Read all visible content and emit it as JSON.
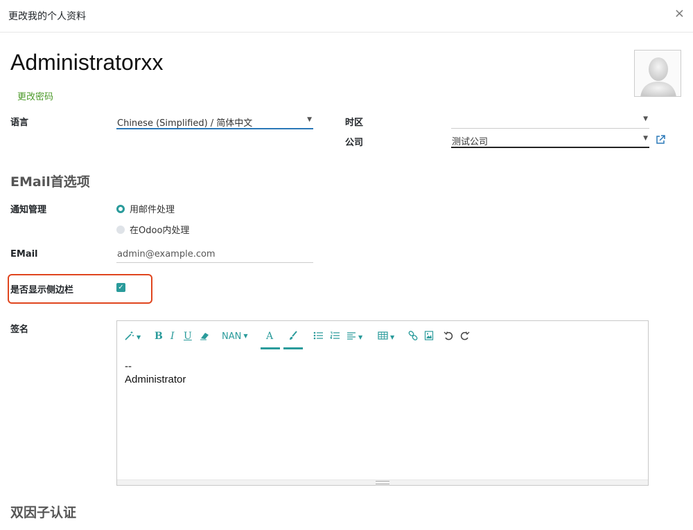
{
  "dialog": {
    "title": "更改我的个人资料",
    "close_glyph": "×"
  },
  "user": {
    "name": "Administratorxx",
    "change_password": "更改密码"
  },
  "fields": {
    "language": {
      "label": "语言",
      "value": "Chinese (Simplified) / 简体中文"
    },
    "timezone": {
      "label": "时区",
      "value": ""
    },
    "company": {
      "label": "公司",
      "value": "测试公司"
    }
  },
  "email_section": {
    "title": "EMail首选项",
    "notification": {
      "label": "通知管理",
      "options": [
        "用邮件处理",
        "在Odoo内处理"
      ],
      "selected": "用邮件处理"
    },
    "email": {
      "label": "EMail",
      "value": "admin@example.com"
    },
    "show_sidebar": {
      "label": "是否显示侧边栏",
      "checked": true
    }
  },
  "signature": {
    "label": "签名",
    "toolbar": {
      "font_size": "NAN",
      "bold": "B",
      "italic": "I",
      "underline": "U",
      "font_color": "A"
    },
    "content_lines": [
      "--",
      "Administrator"
    ]
  },
  "two_factor": {
    "title": "双因子认证"
  },
  "colors": {
    "accent": "#2a9b9b",
    "link_green": "#4c9a2a",
    "highlight": "#e0451e"
  }
}
